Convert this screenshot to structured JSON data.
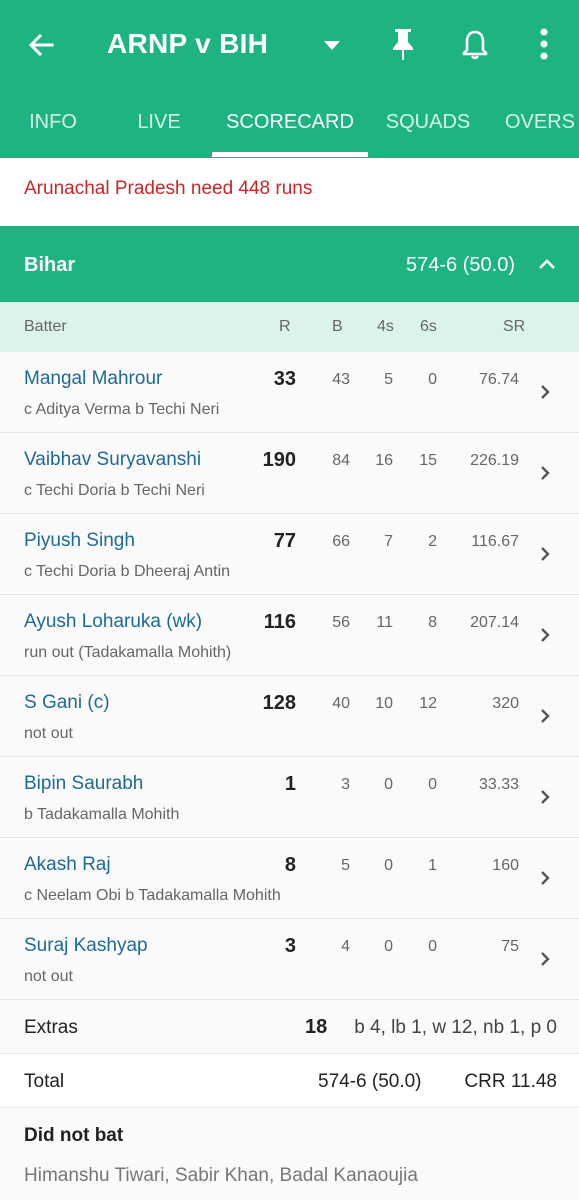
{
  "header": {
    "title": "ARNP v BIH",
    "icons": [
      "back-arrow-icon",
      "dropdown-icon",
      "pin-icon",
      "bell-icon",
      "more-vert-icon"
    ]
  },
  "tabs": [
    {
      "label": "INFO"
    },
    {
      "label": "LIVE"
    },
    {
      "label": "SCORECARD"
    },
    {
      "label": "SQUADS"
    },
    {
      "label": "OVERS"
    }
  ],
  "status": "Arunachal Pradesh need 448 runs",
  "innings": {
    "team": "Bihar",
    "score": "574-6 (50.0)"
  },
  "columns": {
    "batter": "Batter",
    "r": "R",
    "b": "B",
    "fours": "4s",
    "sixes": "6s",
    "sr": "SR"
  },
  "batters": [
    {
      "name": "Mangal Mahrour",
      "dismissal": "c Aditya Verma b Techi Neri",
      "r": "33",
      "b": "43",
      "fours": "5",
      "sixes": "0",
      "sr": "76.74"
    },
    {
      "name": "Vaibhav Suryavanshi",
      "dismissal": "c Techi Doria b Techi Neri",
      "r": "190",
      "b": "84",
      "fours": "16",
      "sixes": "15",
      "sr": "226.19"
    },
    {
      "name": "Piyush Singh",
      "dismissal": "c Techi Doria b Dheeraj Antin",
      "r": "77",
      "b": "66",
      "fours": "7",
      "sixes": "2",
      "sr": "116.67"
    },
    {
      "name": "Ayush Loharuka (wk)",
      "dismissal": "run out (Tadakamalla Mohith)",
      "r": "116",
      "b": "56",
      "fours": "11",
      "sixes": "8",
      "sr": "207.14"
    },
    {
      "name": "S Gani (c)",
      "dismissal": "not out",
      "r": "128",
      "b": "40",
      "fours": "10",
      "sixes": "12",
      "sr": "320"
    },
    {
      "name": "Bipin Saurabh",
      "dismissal": "b Tadakamalla Mohith",
      "r": "1",
      "b": "3",
      "fours": "0",
      "sixes": "0",
      "sr": "33.33"
    },
    {
      "name": "Akash Raj",
      "dismissal": "c Neelam Obi b Tadakamalla Mohith",
      "r": "8",
      "b": "5",
      "fours": "0",
      "sixes": "1",
      "sr": "160"
    },
    {
      "name": "Suraj Kashyap",
      "dismissal": "not out",
      "r": "3",
      "b": "4",
      "fours": "0",
      "sixes": "0",
      "sr": "75"
    }
  ],
  "extras": {
    "label": "Extras",
    "value": "18",
    "detail": "b 4, lb 1, w 12, nb 1, p 0"
  },
  "total": {
    "label": "Total",
    "value": "574-6 (50.0)",
    "crr": "CRR 11.48"
  },
  "did_not_bat": {
    "label": "Did not bat",
    "names": "Himanshu Tiwari, Sabir Khan, Badal Kanaoujia"
  },
  "colors": {
    "primary": "#1eb482",
    "header_row": "#dcf3ea",
    "link": "#1d6a93",
    "alert": "#c62828"
  }
}
